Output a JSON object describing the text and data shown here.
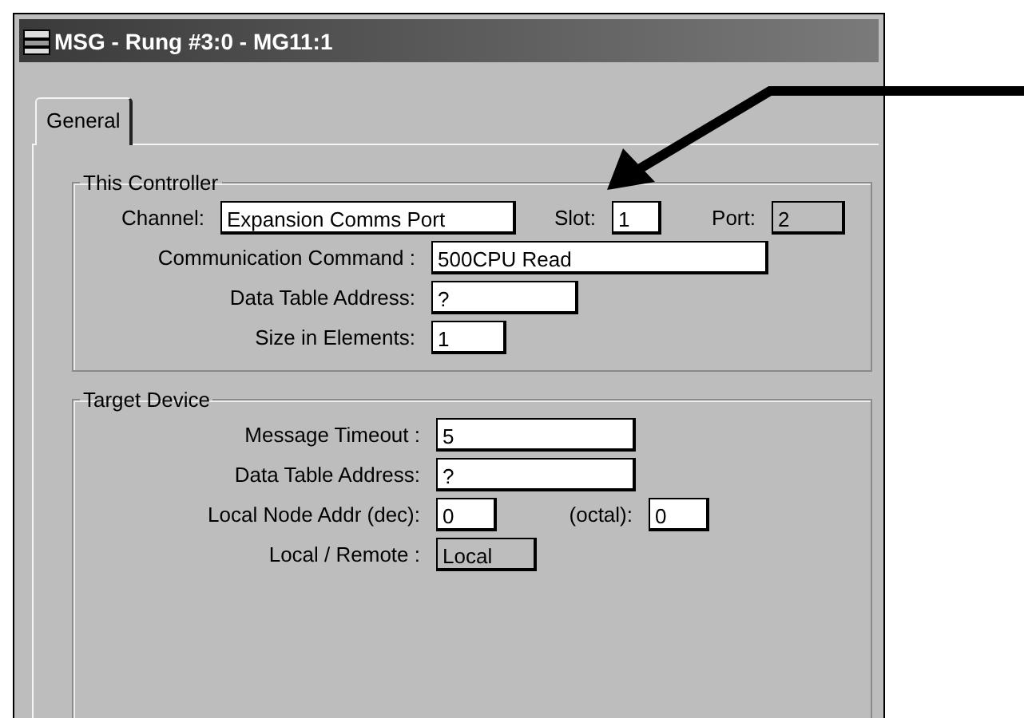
{
  "window": {
    "title": "MSG - Rung #3:0 - MG11:1"
  },
  "tabs": [
    {
      "label": "General",
      "selected": true
    }
  ],
  "this_controller": {
    "title": "This Controller",
    "channel": {
      "label": "Channel:",
      "value": "Expansion Comms Port",
      "disabled": false
    },
    "slot": {
      "label": "Slot:",
      "value": "1",
      "disabled": false
    },
    "port": {
      "label": "Port:",
      "value": "2",
      "disabled": true
    },
    "rows": [
      {
        "label": "Communication Command :",
        "value": "500CPU Read",
        "disabled": false
      },
      {
        "label": "Data Table Address:",
        "value": "?",
        "disabled": false
      },
      {
        "label": "Size in Elements:",
        "value": "1",
        "disabled": false
      }
    ]
  },
  "target_device": {
    "title": "Target Device",
    "rows": [
      {
        "label": "Message Timeout :",
        "value": "5",
        "disabled": false
      },
      {
        "label": "Data Table Address:",
        "value": "?",
        "disabled": false
      }
    ],
    "local_node_addr": {
      "label": "Local Node Addr (dec):",
      "value": "0",
      "disabled": false
    },
    "octal": {
      "label": "(octal):",
      "value": "0",
      "disabled": false
    },
    "local_remote": {
      "label": "Local / Remote :",
      "value": "Local",
      "disabled": true
    }
  }
}
